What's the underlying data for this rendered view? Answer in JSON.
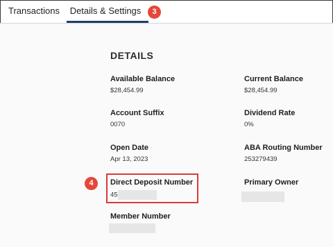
{
  "tabs": {
    "transactions": "Transactions",
    "details_settings": "Details & Settings"
  },
  "markers": {
    "step3": "3",
    "step4": "4"
  },
  "details": {
    "title": "DETAILS",
    "available_balance": {
      "label": "Available Balance",
      "value": "$28,454.99"
    },
    "current_balance": {
      "label": "Current Balance",
      "value": "$28,454.99"
    },
    "account_suffix": {
      "label": "Account Suffix",
      "value": "0070"
    },
    "dividend_rate": {
      "label": "Dividend Rate",
      "value": "0%"
    },
    "open_date": {
      "label": "Open Date",
      "value": "Apr 13, 2023"
    },
    "aba_routing_number": {
      "label": "ABA Routing Number",
      "value": "253279439"
    },
    "direct_deposit_number": {
      "label": "Direct Deposit Number",
      "value_prefix": "45"
    },
    "primary_owner": {
      "label": "Primary Owner"
    },
    "member_number": {
      "label": "Member Number"
    }
  },
  "colors": {
    "accent_underline": "#1f3f6e",
    "marker": "#e4473a",
    "highlight_border": "#d83a3a"
  }
}
